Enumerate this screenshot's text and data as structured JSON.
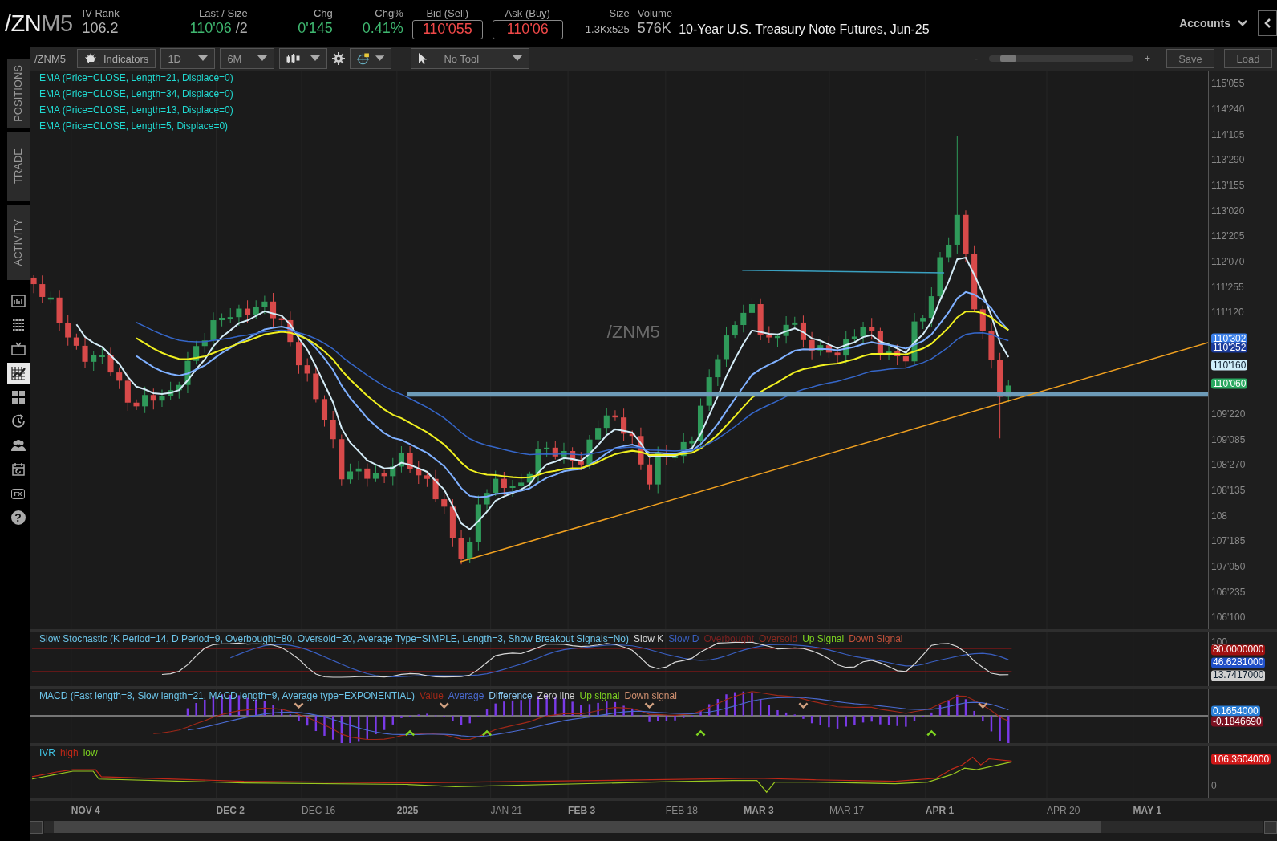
{
  "header": {
    "symbol": "/ZN",
    "symbol_suffix": "M5",
    "quotes": [
      {
        "label": "IV Rank",
        "value": "106.2",
        "color": "#b4b4b4",
        "kind": "plain"
      },
      {
        "label": "Last / Size",
        "value": "110'06",
        "suffix": "/2",
        "color": "#3fb870",
        "kind": "plain"
      },
      {
        "label": "Chg",
        "value": "0'145",
        "color": "#3fb870",
        "kind": "plain"
      },
      {
        "label": "Chg%",
        "value": "0.41%",
        "color": "#3fb870",
        "kind": "plain"
      },
      {
        "label": "Bid (Sell)",
        "value": "110'055",
        "color": "#f04848",
        "kind": "boxed"
      },
      {
        "label": "Ask (Buy)",
        "value": "110'06",
        "color": "#f04848",
        "kind": "boxed"
      },
      {
        "label": "Size",
        "value": "1.3Kx525",
        "color": "#b4b4b4",
        "kind": "small"
      },
      {
        "label": "Volume",
        "value": "576K",
        "color": "#b4b4b4",
        "kind": "plain"
      }
    ],
    "description": "10-Year U.S. Treasury Note Futures, Jun-25",
    "accounts": "Accounts"
  },
  "sidebar": {
    "tabs": [
      {
        "label": "POSITIONS"
      },
      {
        "label": "TRADE"
      },
      {
        "label": "ACTIVITY"
      }
    ],
    "tools": [
      {
        "selected": false
      },
      {
        "selected": false
      },
      {
        "selected": false
      },
      {
        "selected": true
      },
      {
        "selected": false
      },
      {
        "selected": false
      },
      {
        "selected": false
      },
      {
        "selected": false
      },
      {
        "selected": false,
        "label": "FX"
      },
      {
        "selected": false,
        "label": "?"
      }
    ]
  },
  "toolbar": {
    "symbol": "/ZNM5",
    "indicators": "Indicators",
    "aggregation": "1D",
    "period": "6M",
    "tool": "No Tool",
    "zoom_minus": "-",
    "zoom_plus": "+",
    "zoom": {
      "level": 0.08
    },
    "save": "Save",
    "load": "Load"
  },
  "chart": {
    "watermark": "/ZNM5",
    "studies": [
      "EMA (Price=CLOSE, Length=21, Displace=0)",
      "EMA (Price=CLOSE, Length=34, Displace=0)",
      "EMA (Price=CLOSE, Length=13, Displace=0)",
      "EMA (Price=CLOSE, Length=5, Displace=0)"
    ],
    "price_axis": [
      {
        "text": "115'055"
      },
      {
        "text": "114'240"
      },
      {
        "text": "114'105"
      },
      {
        "text": "113'290"
      },
      {
        "text": "113'155"
      },
      {
        "text": "113'020"
      },
      {
        "text": "112'205"
      },
      {
        "text": "112'070"
      },
      {
        "text": "111'255"
      },
      {
        "text": "111'120"
      },
      {
        "text": "110'302",
        "color": "#3a7fe8"
      },
      {
        "text": "110'252",
        "color": "#1a3a9a"
      },
      {
        "text": "110'160",
        "color": "#cfeefa"
      },
      {
        "text": "110'060",
        "color": "#2aa860"
      },
      {
        "text": "109'220"
      },
      {
        "text": "109'085"
      },
      {
        "text": "108'270"
      },
      {
        "text": "108'135"
      },
      {
        "text": "108"
      },
      {
        "text": "107'185"
      },
      {
        "text": "107'050"
      },
      {
        "text": "106'235"
      },
      {
        "text": "106'100"
      }
    ],
    "stochastic": {
      "title": "Slow Stochastic (K Period=14, D Period=9, Overbought=80, Oversold=20, Average Type=SIMPLE, Length=3, Show Breakout Signals=No)",
      "legend": [
        {
          "label": "Slow K",
          "color": "#d8d8d8"
        },
        {
          "label": "Slow D",
          "color": "#3a5fc0"
        },
        {
          "label": "Overbought",
          "color": "#7a2020"
        },
        {
          "label": "Oversold",
          "color": "#8a2a20"
        },
        {
          "label": "Up Signal",
          "color": "#7ed321"
        },
        {
          "label": "Down Signal",
          "color": "#c0503a"
        }
      ],
      "axis": [
        {
          "text": "100"
        },
        {
          "text": "80.0000000",
          "color": "#a01010"
        },
        {
          "text": "46.6281000",
          "color": "#2050c8"
        },
        {
          "text": "13.7417000",
          "color": "#d0d0d0"
        }
      ]
    },
    "macd": {
      "title": "MACD (Fast length=8, Slow length=21, MACD length=9, Average type=EXPONENTIAL)",
      "legend": [
        {
          "label": "Value",
          "color": "#a02818"
        },
        {
          "label": "Average",
          "color": "#4a6ad0"
        },
        {
          "label": "Difference",
          "color": "#8ac8f0"
        },
        {
          "label": "Zero line",
          "color": "#d0d0d0"
        },
        {
          "label": "Up signal",
          "color": "#7ed321"
        },
        {
          "label": "Down signal",
          "color": "#d09070"
        }
      ],
      "axis": [
        {
          "text": "0.1654000",
          "color": "#2a7fd8"
        },
        {
          "text": "-0.1846690",
          "color": "#7a1020"
        }
      ]
    },
    "ivr": {
      "legend": [
        {
          "label": "IVR",
          "color": "#40c0e0"
        },
        {
          "label": "high",
          "color": "#c02818"
        },
        {
          "label": "low",
          "color": "#7ed321"
        }
      ],
      "axis": [
        {
          "text": "106.3604000",
          "color": "#d01818"
        },
        {
          "text": "0"
        }
      ]
    },
    "x_axis": [
      {
        "label": "NOV 4",
        "major": true
      },
      {
        "label": "DEC 2",
        "major": true
      },
      {
        "label": "DEC 16",
        "major": false
      },
      {
        "label": "2025",
        "major": true
      },
      {
        "label": "JAN 21",
        "major": false
      },
      {
        "label": "FEB 3",
        "major": true
      },
      {
        "label": "FEB 18",
        "major": false
      },
      {
        "label": "MAR 3",
        "major": true
      },
      {
        "label": "MAR 17",
        "major": false
      },
      {
        "label": "APR 1",
        "major": true
      },
      {
        "label": "APR 20",
        "major": false
      },
      {
        "label": "MAY 1",
        "major": true
      }
    ]
  }
}
